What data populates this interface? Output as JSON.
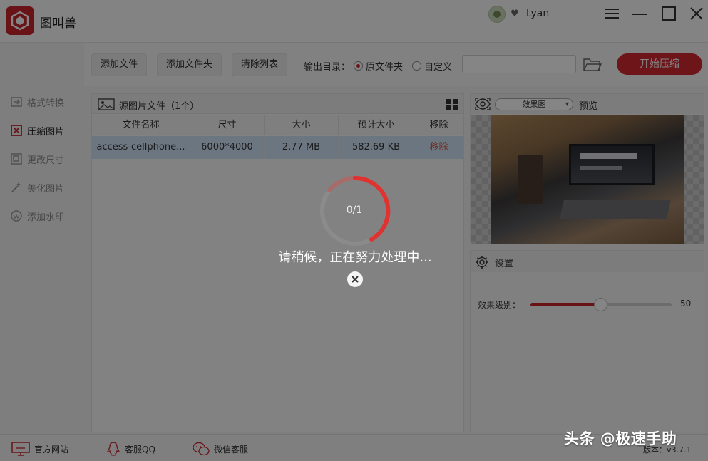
{
  "app": {
    "title": "图叫兽",
    "username": "Lyan"
  },
  "sidebar": {
    "items": [
      {
        "label": "格式转换",
        "icon": "format-convert-icon"
      },
      {
        "label": "压缩图片",
        "icon": "compress-icon",
        "active": true
      },
      {
        "label": "更改尺寸",
        "icon": "resize-icon"
      },
      {
        "label": "美化图片",
        "icon": "beautify-icon"
      },
      {
        "label": "添加水印",
        "icon": "watermark-icon"
      }
    ]
  },
  "toolbar": {
    "add_file": "添加文件",
    "add_folder": "添加文件夹",
    "clear_list": "清除列表",
    "output_label": "输出目录：",
    "radio_original": "原文件夹",
    "radio_custom": "自定义",
    "path_value": "",
    "start_label": "开始压缩"
  },
  "filepanel": {
    "title": "源图片文件（1个）",
    "columns": [
      "文件名称",
      "尺寸",
      "大小",
      "预计大小",
      "移除"
    ],
    "rows": [
      {
        "name": "access-cellphone...",
        "size": "6000*4000",
        "filesize": "2.77 MB",
        "estimated": "582.69 KB",
        "remove": "移除"
      }
    ]
  },
  "preview": {
    "select_value": "效果图",
    "label": "预览"
  },
  "settings": {
    "title": "设置",
    "level_label": "效果级别：",
    "level_value": "50",
    "level_fraction": 0.5
  },
  "footer": {
    "website": "官方网站",
    "qq": "客服QQ",
    "wechat": "微信客服",
    "version": "版本：v3.7.1"
  },
  "overlay": {
    "progress": "0/1",
    "message": "请稍候，正在努力处理中..."
  },
  "watermark": "头条 @极速手助",
  "colors": {
    "accent": "#c9252d",
    "selected_row": "#cfe2f7"
  }
}
